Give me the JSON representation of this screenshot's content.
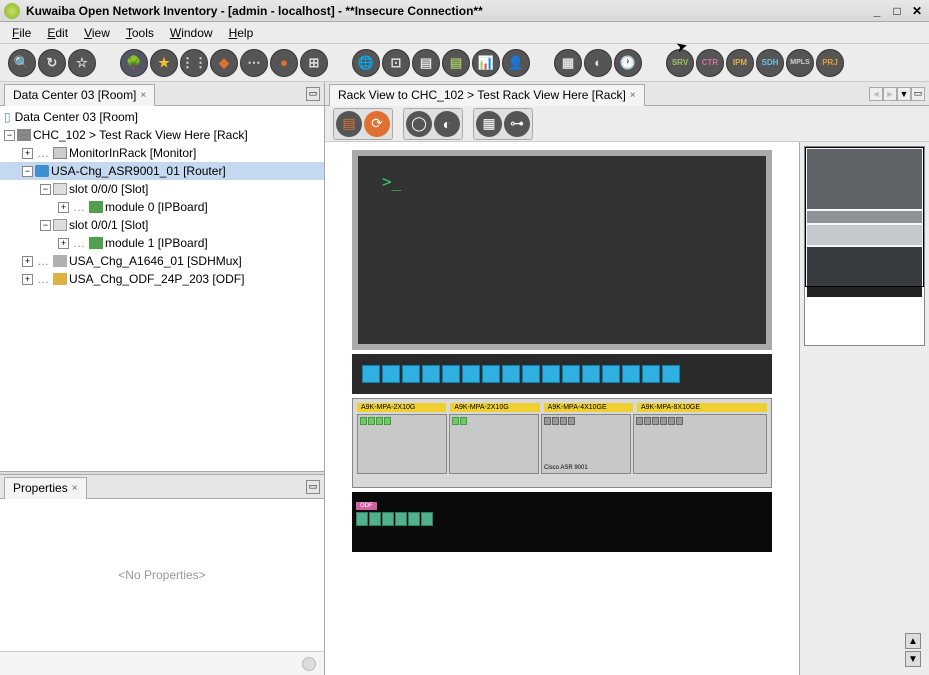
{
  "window": {
    "title": "Kuwaiba Open Network Inventory - [admin - localhost] - **Insecure Connection**"
  },
  "menubar": {
    "file": "File",
    "edit": "Edit",
    "view": "View",
    "tools": "Tools",
    "window": "Window",
    "help": "Help"
  },
  "left_tab": {
    "title": "Data Center 03 [Room]",
    "close": "×"
  },
  "tree": {
    "root": "Data Center 03 [Room]",
    "rack": "CHC_102 > Test Rack View Here [Rack]",
    "monitor": "MonitorInRack [Monitor]",
    "router": "USA-Chg_ASR9001_01 [Router]",
    "slot0": "slot 0/0/0 [Slot]",
    "module0": "module 0 [IPBoard]",
    "slot1": "slot 0/0/1 [Slot]",
    "module1": "module 1 [IPBoard]",
    "sdh": "USA_Chg_A1646_01 [SDHMux]",
    "odf": "USA_Chg_ODF_24P_203 [ODF]",
    "dots": "…"
  },
  "properties": {
    "title": "Properties",
    "close": "×",
    "empty": "<No Properties>"
  },
  "right_tab": {
    "title": "Rack View to CHC_102 > Test Rack View Here [Rack]",
    "close": "×"
  },
  "rack": {
    "prompt": ">_",
    "router_labels": {
      "a": "A9K-MPA-2X10G",
      "b": "A9K-MPA-2X10G",
      "c": "A9K-MPA-4X10GE",
      "d": "A9K-MPA-8X10GE"
    },
    "router_name": "Cisco ASR 9001",
    "odf_name": "ODF"
  }
}
